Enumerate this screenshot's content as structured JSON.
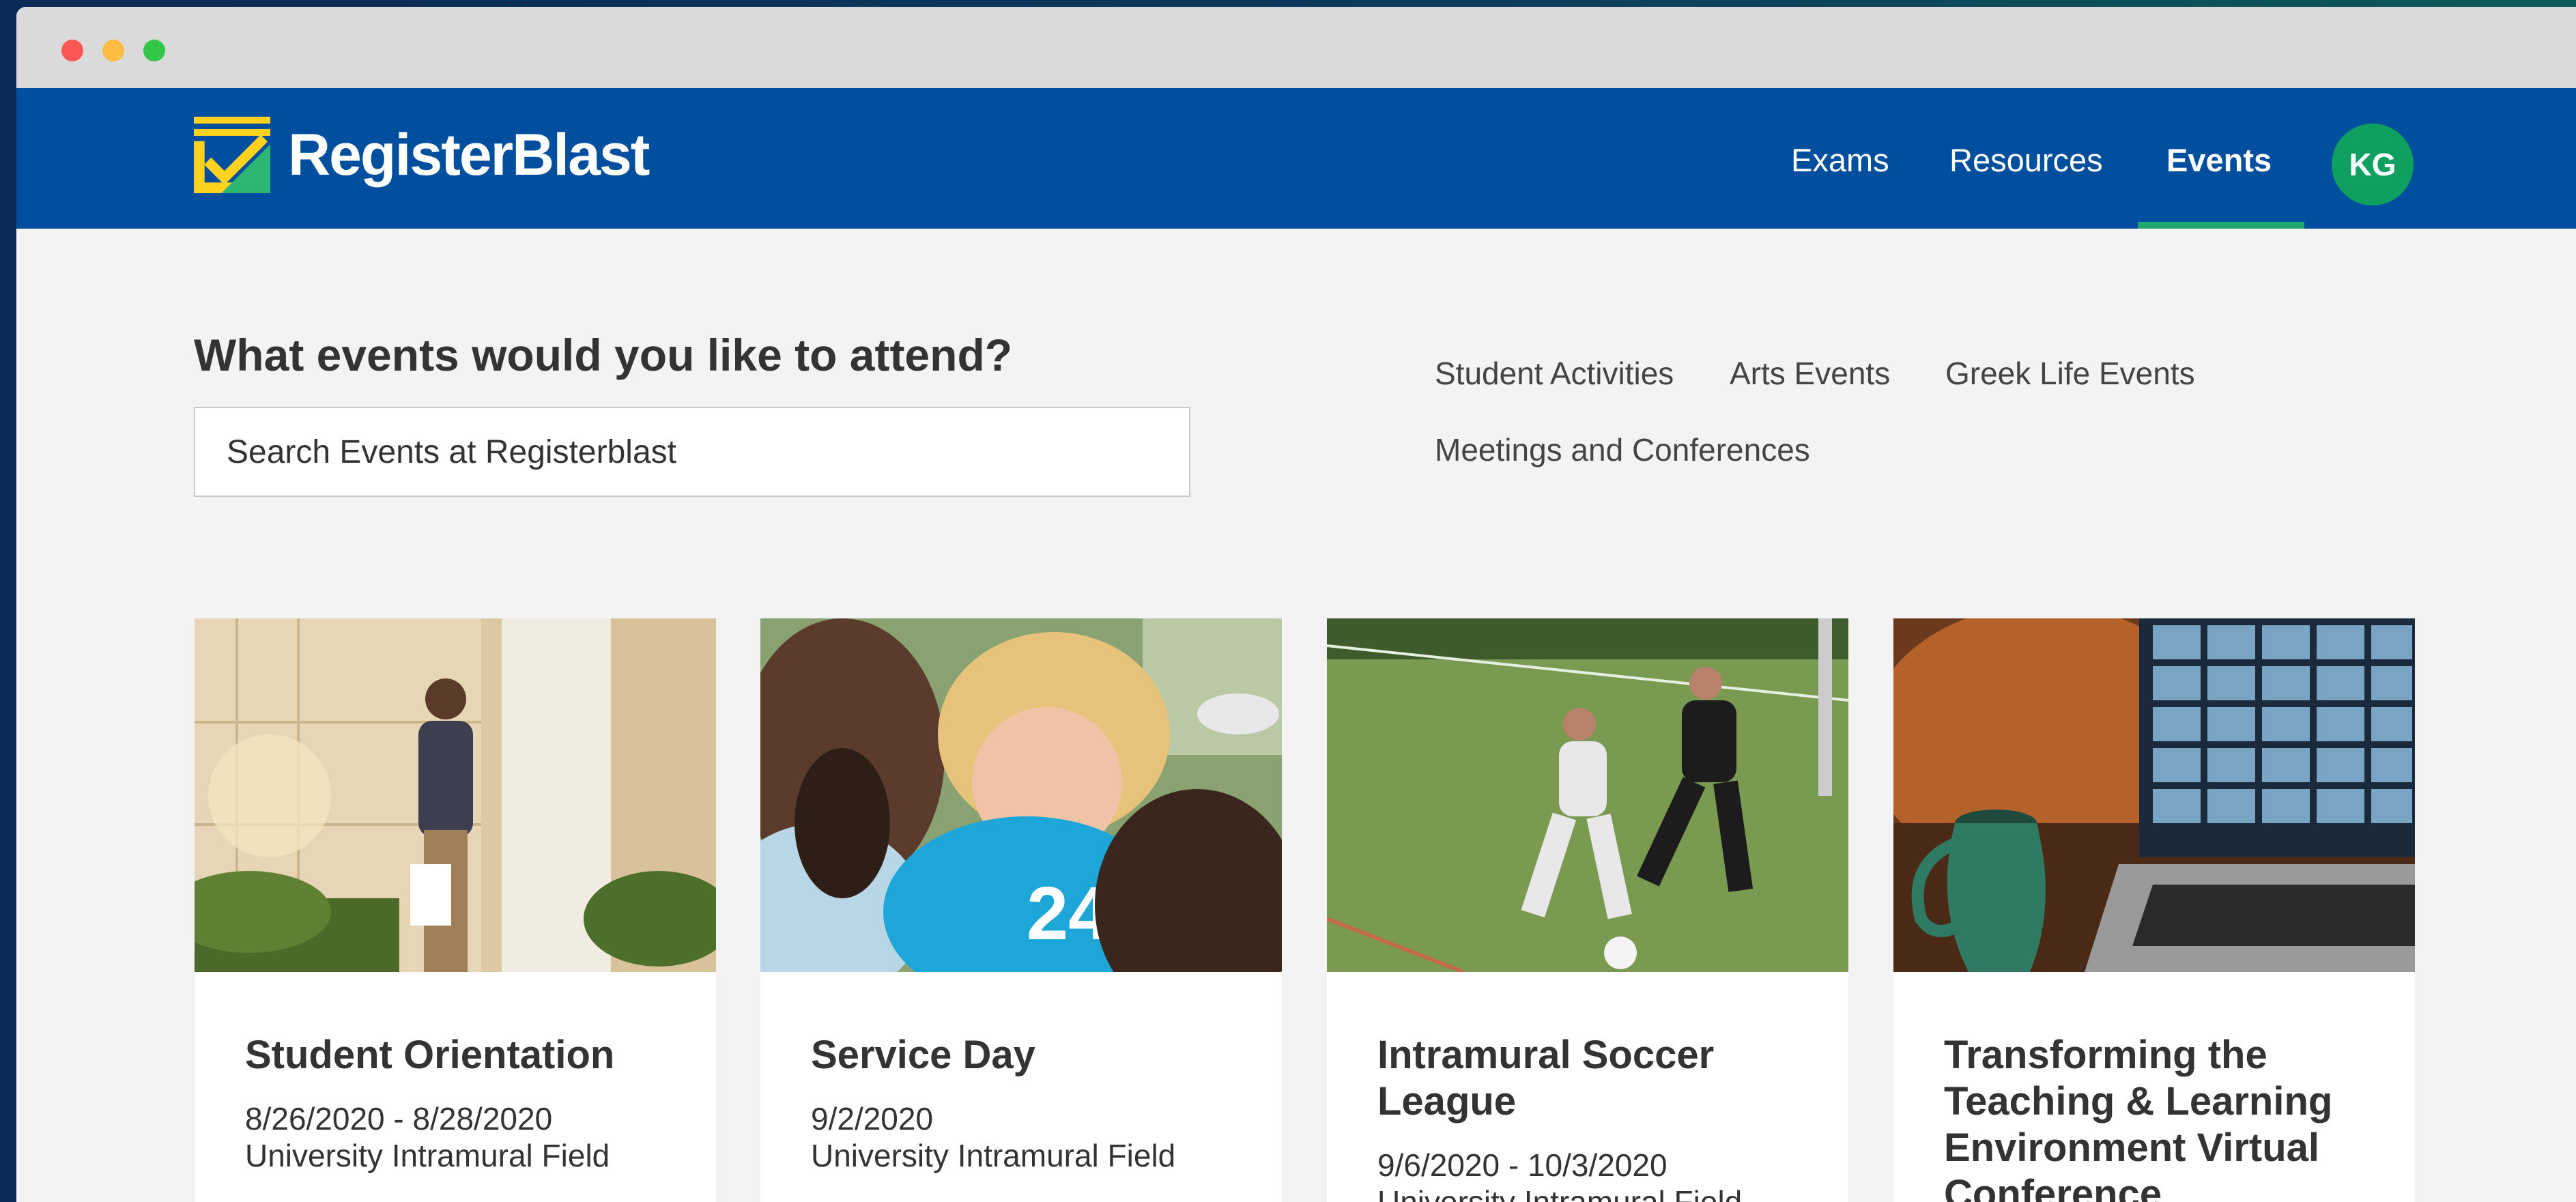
{
  "brand": {
    "name": "RegisterBlast",
    "primary_color": "#004f9f",
    "accent_color": "#1fa86b",
    "logo_yellow": "#ffd21f"
  },
  "nav": {
    "links": [
      {
        "label": "Exams"
      },
      {
        "label": "Resources"
      },
      {
        "label": "Events",
        "active": true
      }
    ],
    "avatar_initials": "KG"
  },
  "search": {
    "heading": "What events would you like to attend?",
    "placeholder": "Search Events at Registerblast",
    "value": ""
  },
  "categories": [
    "Student Activities",
    "Arts Events",
    "Greek Life Events",
    "Meetings and Conferences"
  ],
  "events": [
    {
      "title": "Student Orientation",
      "date": "8/26/2020 - 8/28/2020",
      "location": "University Intramural Field"
    },
    {
      "title": "Service Day",
      "date": "9/2/2020",
      "location": "University Intramural Field"
    },
    {
      "title": "Intramural Soccer League",
      "date": "9/6/2020 - 10/3/2020",
      "location": "University Intramural Field"
    },
    {
      "title": "Transforming the Teaching & Learning Environment Virtual Conference",
      "date": "",
      "location": ""
    }
  ]
}
